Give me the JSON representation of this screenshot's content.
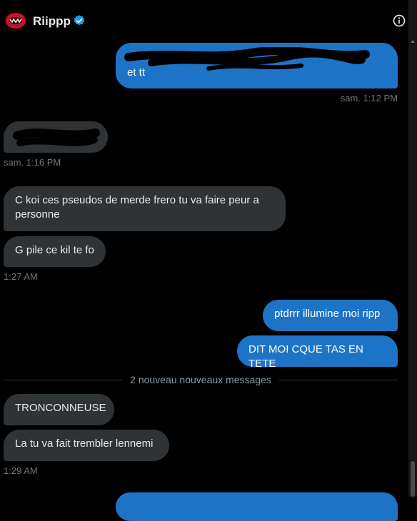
{
  "header": {
    "name": "Riippp",
    "avatar_icon": "avatar-red-mouth-icon",
    "verified_icon": "verified-badge-icon",
    "info_icon": "info-icon"
  },
  "colors": {
    "outgoing_bubble": "#1d74c7",
    "incoming_bubble": "#2f3336",
    "timestamp": "#71767b",
    "background": "#000000",
    "verified": "#1d9bf0"
  },
  "messages": [
    {
      "dir": "out",
      "text": "et tt",
      "redacted_partial": true
    },
    {
      "dir": "time",
      "text": "sam. 1:12 PM"
    },
    {
      "dir": "in",
      "text": "",
      "redacted": true
    },
    {
      "dir": "time",
      "text": "sam. 1:16 PM"
    },
    {
      "dir": "in",
      "text": "C koi ces pseudos de merde frero tu va faire peur a personne"
    },
    {
      "dir": "in",
      "text": "G pile ce kil te fo"
    },
    {
      "dir": "time",
      "text": "1:27 AM"
    },
    {
      "dir": "out",
      "text": "ptdrrr illumine moi ripp"
    },
    {
      "dir": "out",
      "text": "DIT MOI CQUE TAS EN TETE"
    },
    {
      "dir": "divider",
      "text": "2 nouveau nouveaux messages"
    },
    {
      "dir": "in",
      "text": "TRONCONNEUSE"
    },
    {
      "dir": "in",
      "text": "La tu va fait trembler lennemi"
    },
    {
      "dir": "time",
      "text": "1:29 AM"
    }
  ]
}
